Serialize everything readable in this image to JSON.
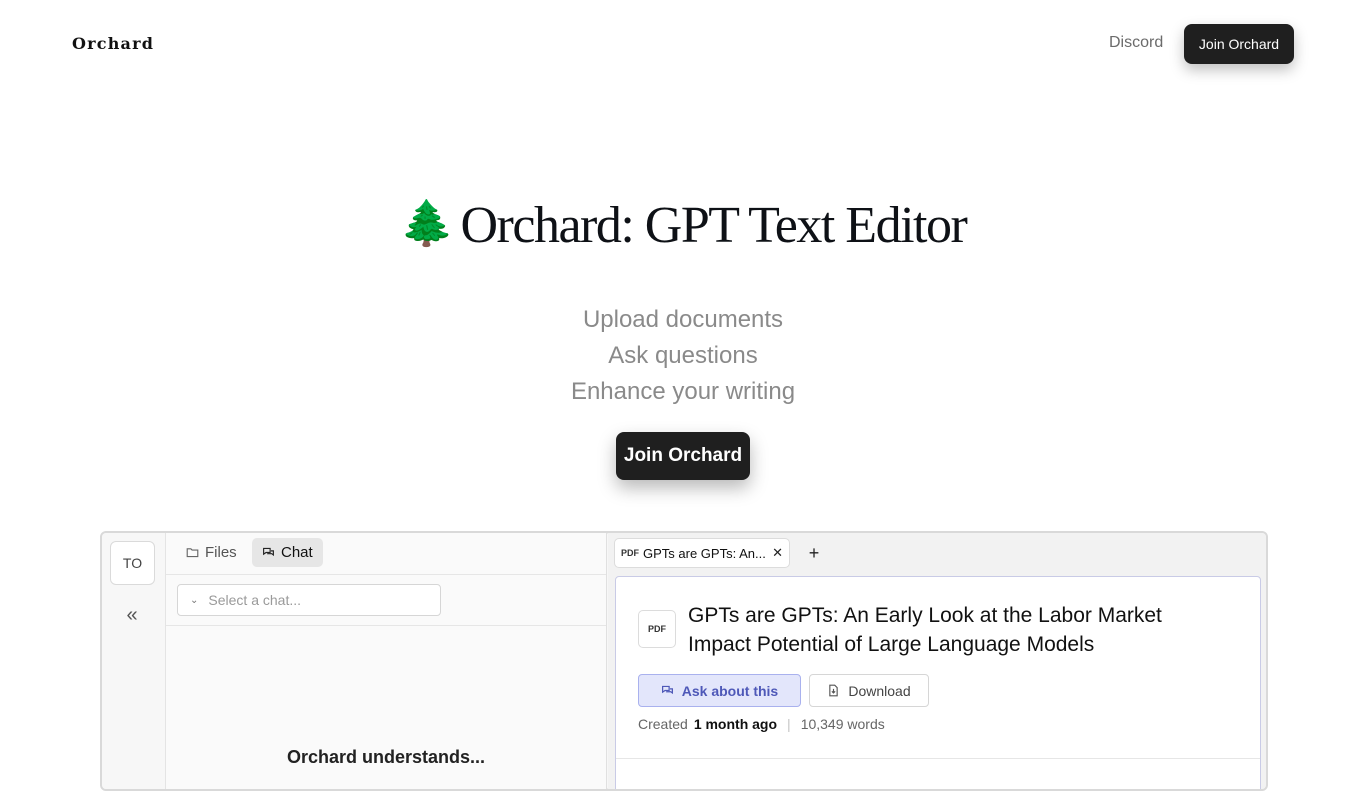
{
  "nav": {
    "brand": "Orchard",
    "discord": "Discord",
    "join": "Join Orchard"
  },
  "hero": {
    "emoji": "🌲",
    "title": "Orchard: GPT Text Editor",
    "taglines": [
      "Upload documents",
      "Ask questions",
      "Enhance your writing"
    ],
    "cta": "Join Orchard"
  },
  "app": {
    "avatar": "TO",
    "collapse_glyph": "«",
    "tabs": [
      "Files",
      "Chat"
    ],
    "select_placeholder": "Select a chat...",
    "understands": "Orchard understands...",
    "doc_tab": {
      "tag": "PDF",
      "title": "GPTs are GPTs: An...",
      "close": "✕"
    },
    "add_tab": "+",
    "document": {
      "badge": "PDF",
      "title": "GPTs are GPTs: An Early Look at the Labor Market Impact Potential of Large Language Models",
      "ask_label": "Ask about this",
      "download_label": "Download",
      "created_prefix": "Created",
      "created_value": "1 month ago",
      "separator": "|",
      "words": "10,349 words"
    }
  },
  "colors": {
    "primary_button": "#1f1f1f",
    "accent_soft": "#e3e6fb",
    "accent_text": "#4e58b8"
  }
}
